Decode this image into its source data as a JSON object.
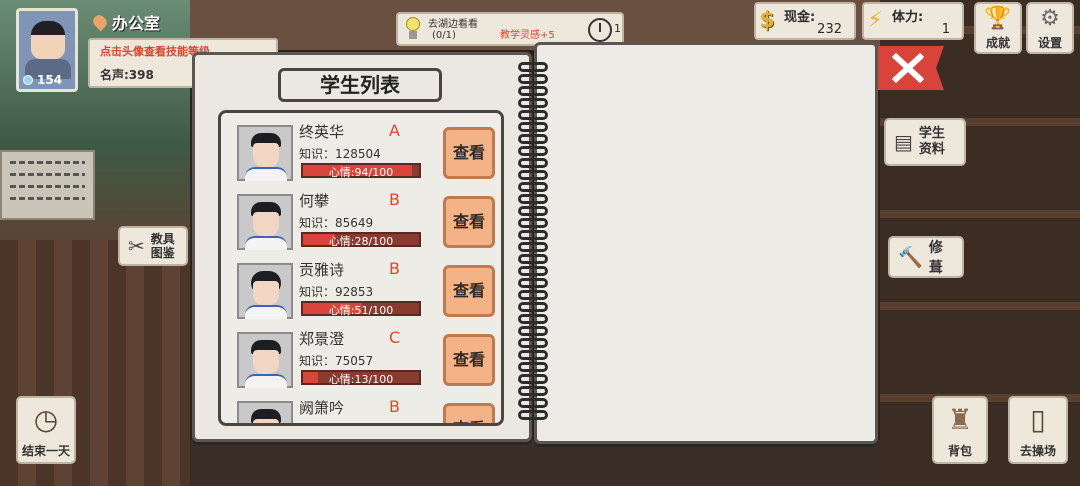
{
  "hud": {
    "location": "办公室",
    "hint": "点击头像查看技能等级",
    "fame_label": "名声:398",
    "avatar_level": "154"
  },
  "quest": {
    "title": "去湖边看看",
    "progress": "(0/1)",
    "reward": "教学灵感+5",
    "count": "1"
  },
  "stats": {
    "cash_label": "现金:",
    "cash_value": "232",
    "stamina_label": "体力:",
    "stamina_value": "1"
  },
  "buttons": {
    "achievements": "成就",
    "settings": "设置",
    "student_info": "学生\n资料",
    "repair": "修葺",
    "tools": "教具\n图鉴",
    "end_day": "结束一天",
    "backpack": "背包",
    "playground": "去操场",
    "view": "查看"
  },
  "student_list": {
    "title": "学生列表",
    "students": [
      {
        "name": "终英华",
        "grade": "A",
        "knowledge": "知识：128504",
        "mood_text": "心情:94/100",
        "mood": 94,
        "gender": "boy"
      },
      {
        "name": "何攀",
        "grade": "B",
        "knowledge": "知识：85649",
        "mood_text": "心情:28/100",
        "mood": 28,
        "gender": "boy"
      },
      {
        "name": "贡雅诗",
        "grade": "B",
        "knowledge": "知识：92853",
        "mood_text": "心情:51/100",
        "mood": 51,
        "gender": "girl"
      },
      {
        "name": "郑景澄",
        "grade": "C",
        "knowledge": "知识：75057",
        "mood_text": "心情:13/100",
        "mood": 13,
        "gender": "boy"
      },
      {
        "name": "阙箫吟",
        "grade": "B",
        "knowledge": "",
        "mood_text": "",
        "mood": 0,
        "gender": "boy"
      }
    ]
  },
  "colors": {
    "accent_red": "#d9462c",
    "mood_fill": "#d9453a",
    "view_button": "#f4b387"
  }
}
